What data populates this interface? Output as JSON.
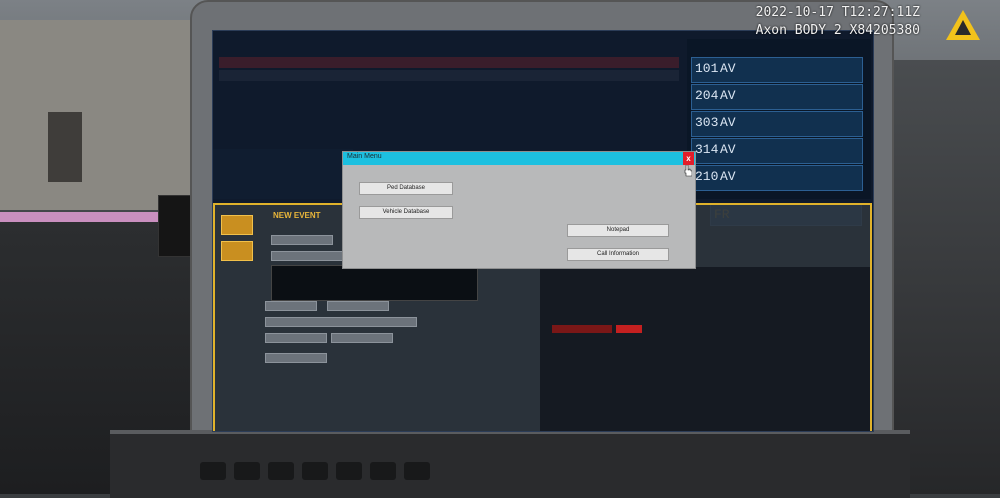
{
  "overlay": {
    "timestamp": "2022-10-17 T12:27:11Z",
    "device": "Axon BODY 2 X84205380",
    "logo_icon": "axon-triangle-logo",
    "logo_color": "#f2c21b"
  },
  "cad": {
    "units": [
      {
        "num": "101",
        "status": "AV"
      },
      {
        "num": "204",
        "status": "AV"
      },
      {
        "num": "303",
        "status": "AV"
      },
      {
        "num": "314",
        "status": "AV"
      },
      {
        "num": "210",
        "status": "AV"
      }
    ],
    "unit_fr": {
      "num": "FR"
    },
    "new_event": {
      "title": "NEW EVENT"
    }
  },
  "main_menu": {
    "title": "Main Menu",
    "close_label": "x",
    "buttons": {
      "ped_database": "Ped Database",
      "vehicle_database": "Vehicle Database",
      "notepad": "Notepad",
      "call_information": "Call Information"
    }
  },
  "colors": {
    "menu_titlebar": "#1cc0e0",
    "close_button": "#e21d2a",
    "event_border": "#e0b22b"
  }
}
